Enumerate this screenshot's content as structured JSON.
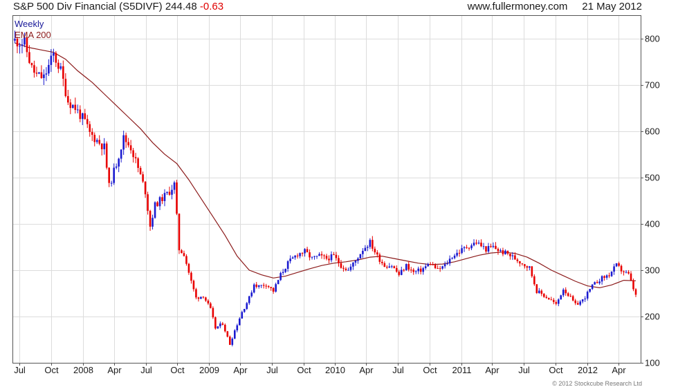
{
  "header": {
    "name": "S&P 500 Div Financial (S5DIVF)",
    "price": "244.48",
    "change": "-0.63",
    "site": "www.fullermoney.com",
    "date": "21 May 2012"
  },
  "copyright": "© 2012 Stockcube Research Ltd",
  "colors": {
    "up": "#1a1ad0",
    "down": "#e80000",
    "ema": "#8b1a1a",
    "grid": "#dcdcdc",
    "axis": "#555555"
  },
  "chart_data": {
    "type": "candlestick",
    "interval_label": "Weekly",
    "legend": [
      "Weekly",
      "EMA 200"
    ],
    "y_range": [
      100,
      850
    ],
    "y_ticks": [
      {
        "value": 100,
        "label": "100"
      },
      {
        "value": 200,
        "label": "200"
      },
      {
        "value": 300,
        "label": "300"
      },
      {
        "value": 400,
        "label": "400"
      },
      {
        "value": 500,
        "label": "500"
      },
      {
        "value": 600,
        "label": "600"
      },
      {
        "value": 700,
        "label": "700"
      },
      {
        "value": 800,
        "label": "800"
      }
    ],
    "x_range": [
      "2007-06-11",
      "2012-06-04"
    ],
    "x_ticks": [
      {
        "date": "2007-07-01",
        "label": "Jul"
      },
      {
        "date": "2007-10-01",
        "label": "Oct"
      },
      {
        "date": "2008-01-01",
        "label": "2008"
      },
      {
        "date": "2008-04-01",
        "label": "Apr"
      },
      {
        "date": "2008-07-01",
        "label": "Jul"
      },
      {
        "date": "2008-10-01",
        "label": "Oct"
      },
      {
        "date": "2009-01-01",
        "label": "2009"
      },
      {
        "date": "2009-04-01",
        "label": "Apr"
      },
      {
        "date": "2009-07-01",
        "label": "Jul"
      },
      {
        "date": "2009-10-01",
        "label": "Oct"
      },
      {
        "date": "2010-01-01",
        "label": "2010"
      },
      {
        "date": "2010-04-01",
        "label": "Apr"
      },
      {
        "date": "2010-07-01",
        "label": "Jul"
      },
      {
        "date": "2010-10-01",
        "label": "Oct"
      },
      {
        "date": "2011-01-01",
        "label": "2011"
      },
      {
        "date": "2011-04-01",
        "label": "Apr"
      },
      {
        "date": "2011-07-01",
        "label": "Jul"
      },
      {
        "date": "2011-10-01",
        "label": "Oct"
      },
      {
        "date": "2012-01-01",
        "label": "2012"
      },
      {
        "date": "2012-04-01",
        "label": "Apr"
      }
    ],
    "price_path": [
      [
        "2007-06-18",
        795
      ],
      [
        "2007-07-16",
        790
      ],
      [
        "2007-08-06",
        735
      ],
      [
        "2007-08-20",
        720
      ],
      [
        "2007-09-10",
        715
      ],
      [
        "2007-10-08",
        765
      ],
      [
        "2007-10-29",
        730
      ],
      [
        "2007-11-19",
        665
      ],
      [
        "2007-12-10",
        650
      ],
      [
        "2008-01-07",
        620
      ],
      [
        "2008-01-21",
        595
      ],
      [
        "2008-02-11",
        580
      ],
      [
        "2008-03-03",
        565
      ],
      [
        "2008-03-17",
        480
      ],
      [
        "2008-04-07",
        530
      ],
      [
        "2008-04-28",
        585
      ],
      [
        "2008-05-19",
        565
      ],
      [
        "2008-06-09",
        520
      ],
      [
        "2008-06-30",
        470
      ],
      [
        "2008-07-14",
        395
      ],
      [
        "2008-07-28",
        440
      ],
      [
        "2008-08-18",
        455
      ],
      [
        "2008-09-08",
        470
      ],
      [
        "2008-09-22",
        485
      ],
      [
        "2008-10-06",
        345
      ],
      [
        "2008-10-20",
        335
      ],
      [
        "2008-11-10",
        275
      ],
      [
        "2008-11-24",
        240
      ],
      [
        "2008-12-15",
        245
      ],
      [
        "2009-01-05",
        215
      ],
      [
        "2009-01-19",
        175
      ],
      [
        "2009-02-09",
        185
      ],
      [
        "2009-03-02",
        140
      ],
      [
        "2009-03-16",
        170
      ],
      [
        "2009-04-06",
        210
      ],
      [
        "2009-04-27",
        240
      ],
      [
        "2009-05-11",
        270
      ],
      [
        "2009-05-25",
        265
      ],
      [
        "2009-06-15",
        270
      ],
      [
        "2009-07-06",
        255
      ],
      [
        "2009-07-27",
        290
      ],
      [
        "2009-08-17",
        315
      ],
      [
        "2009-09-14",
        335
      ],
      [
        "2009-10-05",
        340
      ],
      [
        "2009-10-26",
        325
      ],
      [
        "2009-11-16",
        330
      ],
      [
        "2009-12-07",
        325
      ],
      [
        "2009-12-28",
        330
      ],
      [
        "2010-01-18",
        310
      ],
      [
        "2010-02-08",
        300
      ],
      [
        "2010-03-01",
        320
      ],
      [
        "2010-03-22",
        345
      ],
      [
        "2010-04-12",
        360
      ],
      [
        "2010-05-03",
        330
      ],
      [
        "2010-05-24",
        310
      ],
      [
        "2010-06-14",
        310
      ],
      [
        "2010-07-05",
        290
      ],
      [
        "2010-07-26",
        310
      ],
      [
        "2010-08-16",
        295
      ],
      [
        "2010-09-06",
        300
      ],
      [
        "2010-10-04",
        315
      ],
      [
        "2010-10-25",
        300
      ],
      [
        "2010-11-15",
        310
      ],
      [
        "2010-12-06",
        330
      ],
      [
        "2010-12-27",
        340
      ],
      [
        "2011-01-17",
        350
      ],
      [
        "2011-02-14",
        360
      ],
      [
        "2011-03-14",
        345
      ],
      [
        "2011-04-04",
        350
      ],
      [
        "2011-04-25",
        340
      ],
      [
        "2011-05-16",
        335
      ],
      [
        "2011-06-06",
        325
      ],
      [
        "2011-06-27",
        315
      ],
      [
        "2011-07-18",
        305
      ],
      [
        "2011-08-08",
        255
      ],
      [
        "2011-08-29",
        245
      ],
      [
        "2011-09-19",
        235
      ],
      [
        "2011-10-03",
        225
      ],
      [
        "2011-10-24",
        260
      ],
      [
        "2011-11-14",
        240
      ],
      [
        "2011-11-28",
        225
      ],
      [
        "2011-12-19",
        235
      ],
      [
        "2012-01-16",
        265
      ],
      [
        "2012-02-06",
        280
      ],
      [
        "2012-03-05",
        290
      ],
      [
        "2012-03-26",
        310
      ],
      [
        "2012-04-09",
        300
      ],
      [
        "2012-04-30",
        290
      ],
      [
        "2012-05-14",
        260
      ],
      [
        "2012-05-21",
        244.48
      ]
    ],
    "ema_path": [
      [
        "2007-06-18",
        790
      ],
      [
        "2007-07-30",
        780
      ],
      [
        "2007-09-03",
        775
      ],
      [
        "2007-10-08",
        770
      ],
      [
        "2007-11-12",
        755
      ],
      [
        "2007-12-17",
        730
      ],
      [
        "2008-01-28",
        705
      ],
      [
        "2008-03-03",
        680
      ],
      [
        "2008-04-07",
        655
      ],
      [
        "2008-05-12",
        630
      ],
      [
        "2008-06-16",
        605
      ],
      [
        "2008-07-21",
        575
      ],
      [
        "2008-08-25",
        550
      ],
      [
        "2008-09-29",
        530
      ],
      [
        "2008-11-03",
        495
      ],
      [
        "2008-12-08",
        455
      ],
      [
        "2009-01-12",
        415
      ],
      [
        "2009-02-16",
        375
      ],
      [
        "2009-03-23",
        330
      ],
      [
        "2009-04-27",
        300
      ],
      [
        "2009-06-01",
        290
      ],
      [
        "2009-07-06",
        283
      ],
      [
        "2009-08-10",
        287
      ],
      [
        "2009-09-14",
        295
      ],
      [
        "2009-10-19",
        303
      ],
      [
        "2009-11-23",
        310
      ],
      [
        "2009-12-28",
        315
      ],
      [
        "2010-02-01",
        318
      ],
      [
        "2010-03-08",
        322
      ],
      [
        "2010-04-12",
        328
      ],
      [
        "2010-05-17",
        330
      ],
      [
        "2010-06-21",
        325
      ],
      [
        "2010-07-26",
        320
      ],
      [
        "2010-08-30",
        315
      ],
      [
        "2010-10-04",
        312
      ],
      [
        "2010-11-08",
        313
      ],
      [
        "2010-12-13",
        318
      ],
      [
        "2011-01-17",
        325
      ],
      [
        "2011-02-21",
        332
      ],
      [
        "2011-03-28",
        337
      ],
      [
        "2011-05-02",
        339
      ],
      [
        "2011-06-06",
        336
      ],
      [
        "2011-07-11",
        328
      ],
      [
        "2011-08-15",
        315
      ],
      [
        "2011-09-19",
        300
      ],
      [
        "2011-10-24",
        288
      ],
      [
        "2011-11-28",
        276
      ],
      [
        "2012-01-02",
        266
      ],
      [
        "2012-02-06",
        262
      ],
      [
        "2012-03-12",
        268
      ],
      [
        "2012-04-16",
        278
      ],
      [
        "2012-05-21",
        277
      ]
    ]
  }
}
